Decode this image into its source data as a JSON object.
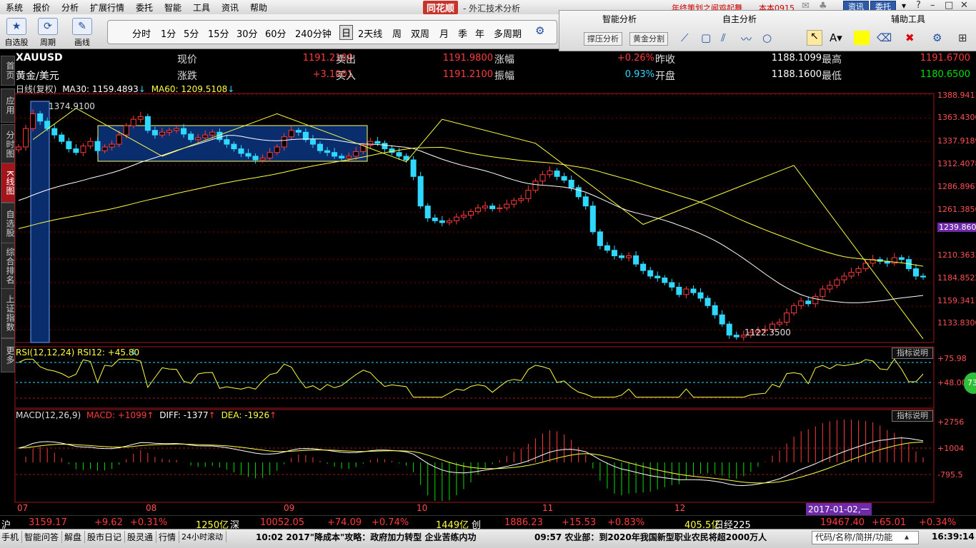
{
  "menu": {
    "items": [
      "系统",
      "报价",
      "分析",
      "扩展行情",
      "委托",
      "智能",
      "工具",
      "资讯",
      "帮助"
    ],
    "brand": "同花顺",
    "window_title": "- 外汇技术分析",
    "promo": "年终策划之闻鸡起舞",
    "account": "本本0915",
    "btn_news": "资讯",
    "btn_trade": "委托"
  },
  "toolbar": {
    "tools": [
      {
        "label": "自选股",
        "icon": "★"
      },
      {
        "label": "周期",
        "icon": "⟳"
      },
      {
        "label": "画线",
        "icon": "✎"
      }
    ],
    "periods": [
      "分时",
      "1分",
      "5分",
      "15分",
      "30分",
      "60分",
      "240分钟",
      "日",
      "2天线",
      "周",
      "双周",
      "月",
      "季",
      "年",
      "多周期"
    ],
    "active_period": "日"
  },
  "right_panel": {
    "smart": "智能分析",
    "self": "自主分析",
    "aux": "辅助工具",
    "pressure_btn": "撑压分析",
    "golden_btn": "黄金分割"
  },
  "side_tabs": [
    "首页",
    "应用",
    "分时图",
    "K线图",
    "自选股",
    "综合排名",
    "上证指数",
    "更多"
  ],
  "quote": {
    "symbol": "XAUUSD",
    "name": "黄金/美元",
    "now_label": "现价",
    "now": "1191.2100",
    "sell_label": "卖出",
    "sell": "1191.9800",
    "pct_label": "涨幅",
    "pct": "+0.26%",
    "prev_label": "昨收",
    "prev": "1188.1099",
    "high_label": "最高",
    "high": "1191.6700",
    "chg_label": "涨跌",
    "chg": "+3.1001",
    "buy_label": "买入",
    "buy": "1191.2100",
    "amp_label": "振幅",
    "amp": "0.93%",
    "open_label": "开盘",
    "open": "1188.1600",
    "low_label": "最低",
    "low": "1180.6500"
  },
  "main_legend": {
    "line": "日线(复权)",
    "ma30": "MA30: 1159.4893",
    "ma60": "MA60: 1209.5108"
  },
  "annotations": {
    "high": "1374.9100",
    "low": "1122.3500"
  },
  "price_axis": [
    "1388.9411",
    "1363.4300",
    "1337.9189",
    "1312.4078",
    "1286.8967",
    "1261.3856",
    "1239.8600",
    "1210.3633",
    "1184.8522",
    "1159.3411",
    "1133.8300"
  ],
  "rsi": {
    "legend": "RSI(12,12,24) RSI12: +45.80",
    "btn": "指标说明",
    "levels": [
      "+75.98",
      "+48.00"
    ],
    "badge": "73"
  },
  "macd": {
    "title": "MACD(12,26,9)",
    "macd": "MACD: +1099",
    "diff": "DIFF: -1377",
    "dea": "DEA: -1926",
    "btn": "指标说明",
    "levels": [
      "+2756",
      "+1004",
      "-795.5"
    ]
  },
  "x_axis": [
    "07",
    "08",
    "09",
    "10",
    "11",
    "12"
  ],
  "cursor_date": "2017-01-02,一",
  "indices": {
    "sh_label": "沪",
    "sh": "3159.17",
    "sh_chg": "+9.62",
    "sh_pct": "+0.31%",
    "sh_amt": "1250亿",
    "sz_label": "深",
    "sz": "10052.05",
    "sz_chg": "+74.09",
    "sz_pct": "+0.74%",
    "sz_amt": "1449亿",
    "cy_label": "创",
    "cy": "1886.23",
    "cy_chg": "+15.53",
    "cy_pct": "+0.83%",
    "cy_amt": "405.5亿",
    "nk_label": "日经225",
    "nk": "19467.40",
    "nk_chg": "+65.01",
    "nk_pct": "+0.34%"
  },
  "status": {
    "items": [
      "手机",
      "智能问答",
      "解盘",
      "股市日记",
      "股灵通",
      "行情",
      "24小时滚动"
    ],
    "news1": "10:02 2017\"降成本\"攻略：政府加力转型 企业苦练内功",
    "news2": "09:57 农业部：到2020年我国新型职业农民将超2000万人",
    "search": "代码/名称/简拼/功能",
    "time": "16:39:14"
  },
  "chart_data": {
    "type": "candlestick",
    "x_months": [
      "07",
      "08",
      "09",
      "10",
      "11",
      "12"
    ],
    "price_range": [
      1120,
      1390
    ],
    "close": [
      1332,
      1352,
      1368,
      1360,
      1352,
      1345,
      1338,
      1330,
      1326,
      1333,
      1338,
      1328,
      1332,
      1335,
      1345,
      1355,
      1362,
      1365,
      1350,
      1345,
      1348,
      1350,
      1352,
      1346,
      1340,
      1342,
      1345,
      1348,
      1340,
      1335,
      1330,
      1325,
      1322,
      1318,
      1320,
      1326,
      1332,
      1343,
      1350,
      1348,
      1340,
      1335,
      1328,
      1326,
      1322,
      1320,
      1322,
      1327,
      1334,
      1338,
      1336,
      1330,
      1326,
      1322,
      1318,
      1300,
      1268,
      1255,
      1252,
      1250,
      1252,
      1256,
      1258,
      1262,
      1266,
      1268,
      1265,
      1266,
      1270,
      1274,
      1276,
      1285,
      1295,
      1302,
      1306,
      1300,
      1296,
      1288,
      1278,
      1268,
      1240,
      1225,
      1220,
      1214,
      1212,
      1214,
      1205,
      1198,
      1192,
      1190,
      1185,
      1180,
      1172,
      1178,
      1174,
      1168,
      1160,
      1150,
      1140,
      1128,
      1126,
      1128,
      1131,
      1133,
      1134,
      1140,
      1142,
      1152,
      1160,
      1165,
      1162,
      1170,
      1178,
      1182,
      1188,
      1192,
      1196,
      1200,
      1206,
      1210,
      1208,
      1206,
      1212,
      1210,
      1200,
      1192,
      1191
    ]
  }
}
